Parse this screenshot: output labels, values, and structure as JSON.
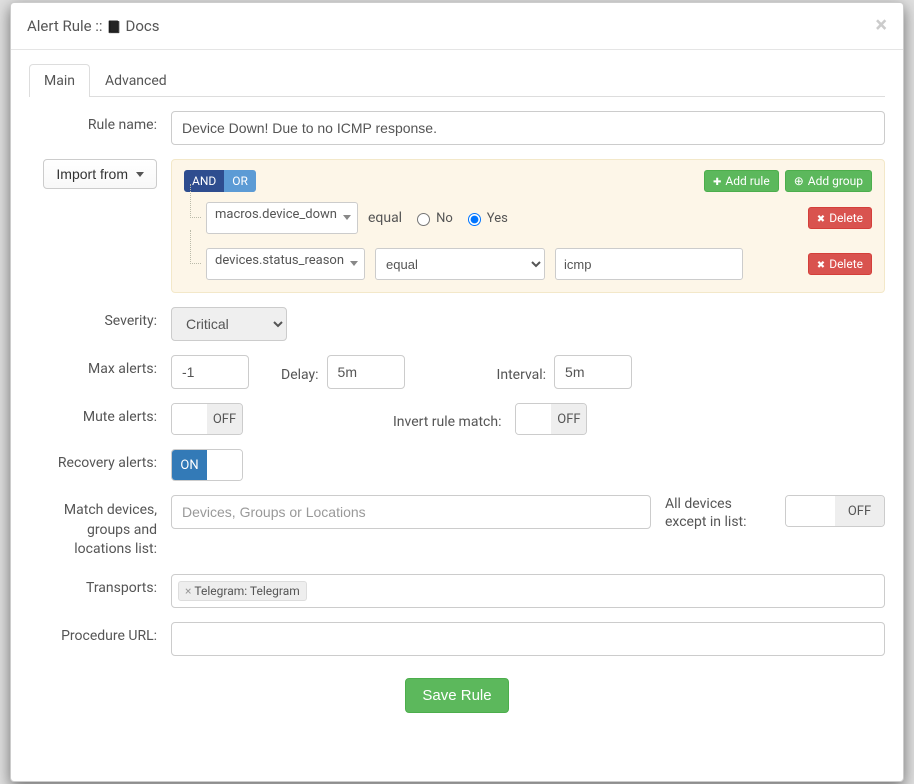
{
  "modal": {
    "title_prefix": "Alert Rule :: ",
    "docs_label": "Docs",
    "close": "×"
  },
  "tabs": {
    "main": "Main",
    "advanced": "Advanced"
  },
  "labels": {
    "rule_name": "Rule name:",
    "import_from": "Import from",
    "severity": "Severity:",
    "max_alerts": "Max alerts:",
    "delay": "Delay:",
    "interval": "Interval:",
    "mute_alerts": "Mute alerts:",
    "invert": "Invert rule match:",
    "recovery": "Recovery alerts:",
    "match_list": "Match devices, groups and locations list:",
    "except": "All devices except in list:",
    "transports": "Transports:",
    "procedure_url": "Procedure URL:",
    "match_placeholder": "Devices, Groups or Locations"
  },
  "values": {
    "rule_name": "Device Down! Due to no ICMP response.",
    "severity": "Critical",
    "max_alerts": "-1",
    "delay": "5m",
    "interval": "5m",
    "procedure_url": ""
  },
  "builder": {
    "and": "AND",
    "or": "OR",
    "add_rule": "Add rule",
    "add_group": "Add group",
    "delete": "Delete",
    "op_equal": "equal",
    "no": "No",
    "yes": "Yes",
    "rule1_field": "macros.device_down",
    "rule2_field": "devices.status_reason",
    "rule2_value": "icmp"
  },
  "toggles": {
    "on": "ON",
    "off": "OFF"
  },
  "transports_tag": "Telegram: Telegram",
  "save": "Save Rule"
}
